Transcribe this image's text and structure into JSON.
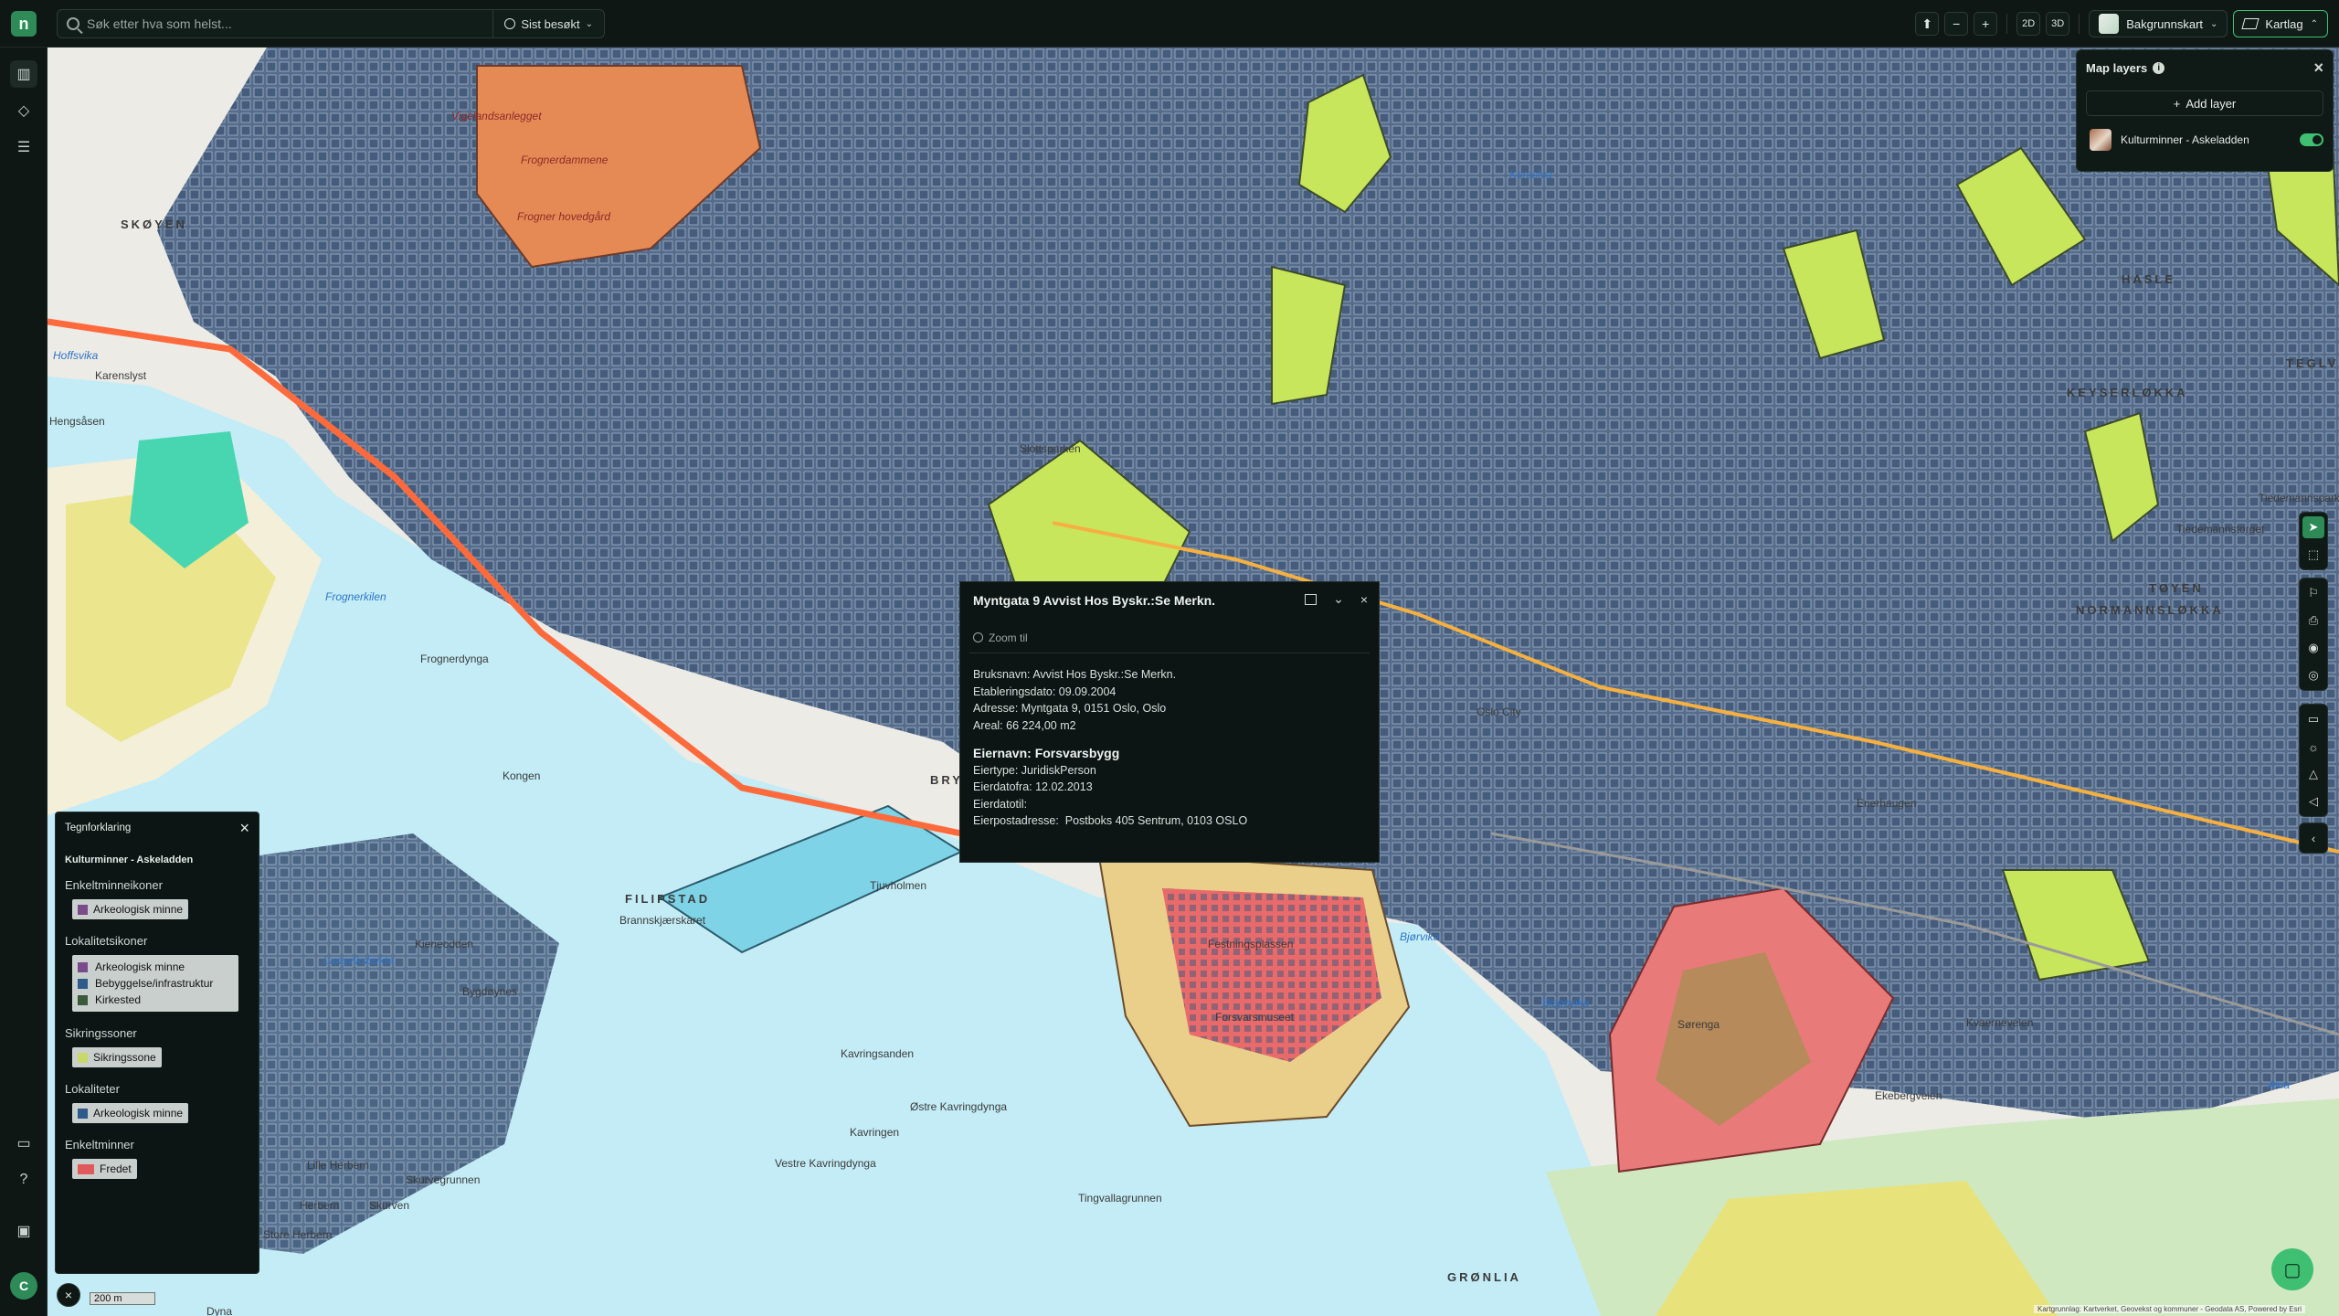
{
  "topbar": {
    "logo": "n",
    "search_placeholder": "Søk etter hva som helst...",
    "recent_label": "Sist besøkt",
    "zoom_minus": "−",
    "zoom_plus": "+",
    "view_2d": "2D",
    "view_3d": "3D",
    "basemap_label": "Bakgrunnskart",
    "maplayers_label": "Kartlag"
  },
  "sidebar": {
    "avatar_initial": "C"
  },
  "layers_panel": {
    "title": "Map layers",
    "add_label": "Add layer",
    "layer_name": "Kulturminner - Askeladden"
  },
  "popup": {
    "title": "Myntgata 9 Avvist Hos Byskr.:Se Merkn.",
    "zoom_label": "Zoom til",
    "lines1": [
      "Bruksnavn: Avvist Hos Byskr.:Se Merkn.",
      "Etableringsdato: 09.09.2004",
      "Adresse: Myntgata 9, 0151 Oslo, Oslo",
      "Areal: 66 224,00 m2"
    ],
    "owner_heading": "Eiernavn: Forsvarsbygg",
    "lines2": [
      "Eiertype: JuridiskPerson",
      "Eierdatofra: 12.02.2013",
      "Eierdatotil:",
      "Eierpostadresse:  Postboks 405 Sentrum, 0103 OSLO"
    ]
  },
  "legend": {
    "title": "Tegnforklaring",
    "layer": "Kulturminner - Askeladden",
    "sec1": "Enkeltminneikoner",
    "sec1_item": "Arkeologisk minne",
    "sec2": "Lokalitetsikoner",
    "sec2_items": [
      "Arkeologisk minne",
      "Bebyggelse/infrastruktur",
      "Kirkested"
    ],
    "sec3": "Sikringssoner",
    "sec3_item": "Sikringssone",
    "sec4": "Lokaliteter",
    "sec4_item": "Arkeologisk minne",
    "sec5": "Enkeltminner",
    "sec5_item": "Fredet",
    "colors": {
      "arch": "#7a4b8a",
      "bebygg": "#2f5a8a",
      "kirke": "#3a5a3a",
      "sikring": "#c8d86a",
      "fredet": "#e05a5a"
    }
  },
  "scale": {
    "label": "200 m"
  },
  "attribution": "Kartgrunnlag: Kartverket, Geovekst og kommuner - Geodata AS, Powered by Esri",
  "map": {
    "labels": [
      {
        "t": "SKØYEN",
        "c": "district"
      },
      {
        "t": "HASLE",
        "c": "district"
      },
      {
        "t": "KEYSERLØKKA",
        "c": "district"
      },
      {
        "t": "TEGLVE",
        "c": "district"
      },
      {
        "t": "TØYEN",
        "c": "district"
      },
      {
        "t": "NORMANNSLØKKA",
        "c": "district"
      },
      {
        "t": "FILIPSTAD",
        "c": "district"
      },
      {
        "t": "GRØNLIA",
        "c": "district"
      },
      {
        "t": "BRY",
        "c": "district"
      },
      {
        "t": "Frognerdammene",
        "c": ""
      },
      {
        "t": "Frogner hovedgård",
        "c": ""
      },
      {
        "t": "Vigelandsanlegget",
        "c": ""
      },
      {
        "t": "Slottsparken",
        "c": ""
      },
      {
        "t": "Hoffsvika",
        "c": "water"
      },
      {
        "t": "Frognerkilen",
        "c": "water"
      },
      {
        "t": "Frognerdynga",
        "c": ""
      },
      {
        "t": "Karenslyst",
        "c": ""
      },
      {
        "t": "Hengsåsen",
        "c": ""
      },
      {
        "t": "Kongen",
        "c": ""
      },
      {
        "t": "Dyna",
        "c": ""
      },
      {
        "t": "Tjuvholmen",
        "c": ""
      },
      {
        "t": "Brannskjærskaret",
        "c": ""
      },
      {
        "t": "Langviksbukta",
        "c": "water"
      },
      {
        "t": "Kieneodden",
        "c": ""
      },
      {
        "t": "Bygdøynes",
        "c": ""
      },
      {
        "t": "Kavringsanden",
        "c": ""
      },
      {
        "t": "Østre Kavringdynga",
        "c": ""
      },
      {
        "t": "Kavringen",
        "c": ""
      },
      {
        "t": "Vestre Kavringdynga",
        "c": ""
      },
      {
        "t": "Tingvallagrunnen",
        "c": ""
      },
      {
        "t": "Lille Herbern",
        "c": ""
      },
      {
        "t": "Skurvegrunnen",
        "c": ""
      },
      {
        "t": "Herbern",
        "c": ""
      },
      {
        "t": "Skurven",
        "c": ""
      },
      {
        "t": "Store Herbern",
        "c": ""
      },
      {
        "t": "Bjørvika",
        "c": "water"
      },
      {
        "t": "Bispevika",
        "c": "water"
      },
      {
        "t": "Festningsplassen",
        "c": ""
      },
      {
        "t": "Forsvarsmuseet",
        "c": ""
      },
      {
        "t": "Sørenga",
        "c": ""
      },
      {
        "t": "Alna",
        "c": "water"
      },
      {
        "t": "Oslo City",
        "c": ""
      },
      {
        "t": "Tiedemannsparken",
        "c": ""
      },
      {
        "t": "Tiedemannstorget",
        "c": ""
      },
      {
        "t": "Kerselva",
        "c": "water"
      },
      {
        "t": "Enerhaugen",
        "c": ""
      },
      {
        "t": "Kvaerneveien",
        "c": ""
      },
      {
        "t": "Ekebergveien",
        "c": ""
      }
    ]
  }
}
